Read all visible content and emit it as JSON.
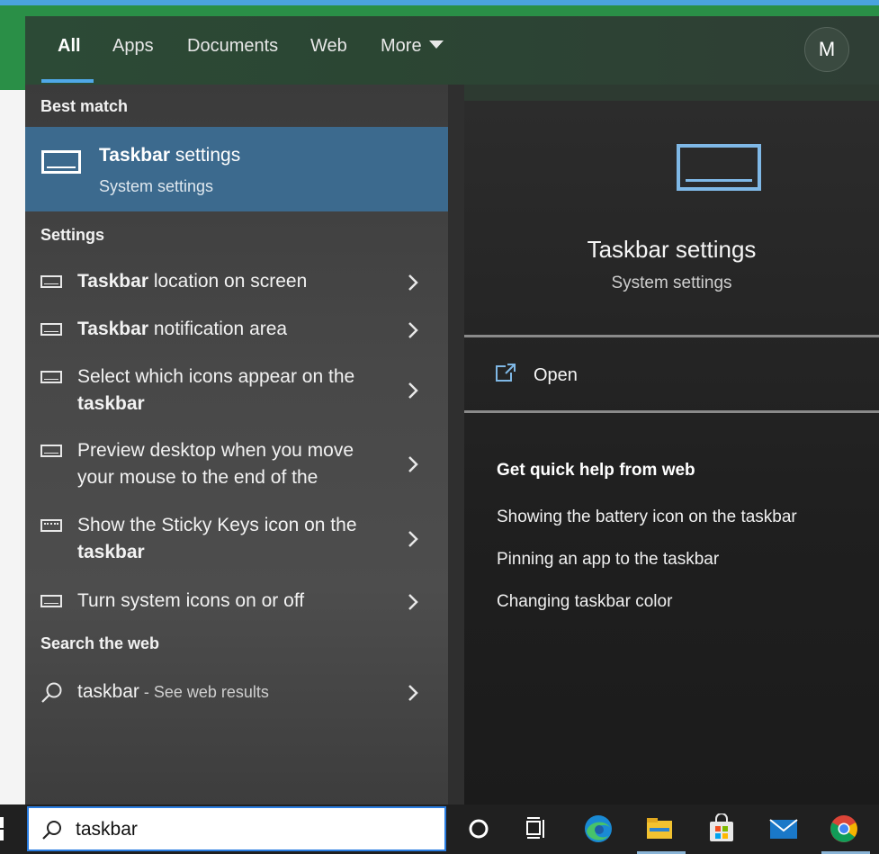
{
  "header": {
    "tabs": [
      {
        "label": "All"
      },
      {
        "label": "Apps"
      },
      {
        "label": "Documents"
      },
      {
        "label": "Web"
      },
      {
        "label": "More"
      }
    ],
    "avatar_initial": "M"
  },
  "sections": {
    "best_match": "Best match",
    "settings": "Settings",
    "search_web": "Search the web"
  },
  "best_match": {
    "title_bold": "Taskbar",
    "title_rest": " settings",
    "subtitle": "System settings"
  },
  "settings_items": [
    {
      "pre": "",
      "bold": "Taskbar",
      "post": " location on screen",
      "icon": "monitor-icon"
    },
    {
      "pre": "",
      "bold": "Taskbar",
      "post": " notification area",
      "icon": "monitor-icon"
    },
    {
      "pre": "Select which icons appear on the ",
      "bold": "taskbar",
      "post": "",
      "icon": "monitor-icon"
    },
    {
      "pre": "Preview desktop when you move your mouse to the end of the",
      "bold": "",
      "post": "",
      "icon": "monitor-icon"
    },
    {
      "pre": "Show the Sticky Keys icon on the ",
      "bold": "taskbar",
      "post": "",
      "icon": "keyboard-icon"
    },
    {
      "pre": "Turn system icons on or off",
      "bold": "",
      "post": "",
      "icon": "monitor-icon"
    }
  ],
  "web_result": {
    "query": "taskbar",
    "suffix": " - See web results"
  },
  "detail": {
    "title": "Taskbar settings",
    "subtitle": "System settings",
    "open_label": "Open",
    "help_title": "Get quick help from web",
    "help_links": [
      "Showing the battery icon on the taskbar",
      "Pinning an app to the taskbar",
      "Changing taskbar color"
    ]
  },
  "search": {
    "value": "taskbar"
  },
  "taskbar_icons": [
    "cortana-icon",
    "task-view-icon",
    "edge-icon",
    "file-explorer-icon",
    "store-icon",
    "mail-icon",
    "chrome-icon"
  ],
  "colors": {
    "accent": "#3c6a8e",
    "search_border": "#2a7de1",
    "icon_blue": "#7fb8e6"
  }
}
